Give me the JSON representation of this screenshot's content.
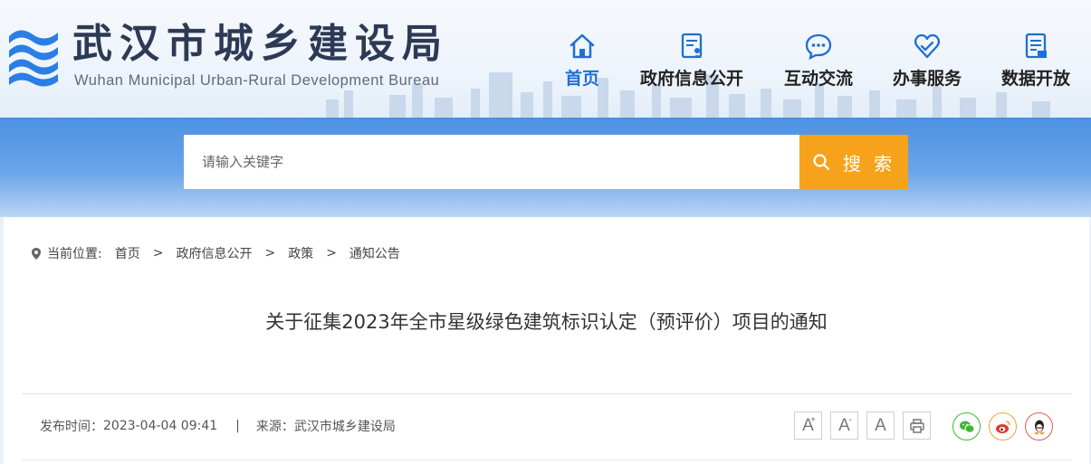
{
  "header": {
    "title": "武汉市城乡建设局",
    "subtitle": "Wuhan Municipal Urban-Rural Development Bureau"
  },
  "nav": {
    "items": [
      {
        "label": "首页",
        "icon": "home-icon",
        "active": true
      },
      {
        "label": "政府信息公开",
        "icon": "document-user-icon",
        "active": false
      },
      {
        "label": "互动交流",
        "icon": "chat-bubble-icon",
        "active": false
      },
      {
        "label": "办事服务",
        "icon": "heart-hands-icon",
        "active": false
      },
      {
        "label": "数据开放",
        "icon": "data-document-icon",
        "active": false
      }
    ]
  },
  "search": {
    "placeholder": "请输入关键字",
    "value": "",
    "button_label": "搜 索"
  },
  "breadcrumb": {
    "prefix": "当前位置:",
    "items": [
      "首页",
      "政府信息公开",
      "政策",
      "通知公告"
    ],
    "separator": ">"
  },
  "article": {
    "title": "关于征集2023年全市星级绿色建筑标识认定（预评价）项目的通知",
    "publish_label": "发布时间：",
    "publish_time": "2023-04-04 09:41",
    "meta_separator": "|",
    "source_label": "来源：",
    "source": "武汉市城乡建设局"
  },
  "tools": {
    "font_large": "A",
    "font_large_mark": "+",
    "font_small": "A",
    "font_small_mark": "-",
    "font_reset": "A"
  },
  "colors": {
    "accent_blue": "#1e6fd6",
    "search_orange": "#f7a21b",
    "wechat_green": "#3db833",
    "weibo_orange": "#f0a33a",
    "qq_red": "#e05a4a"
  }
}
